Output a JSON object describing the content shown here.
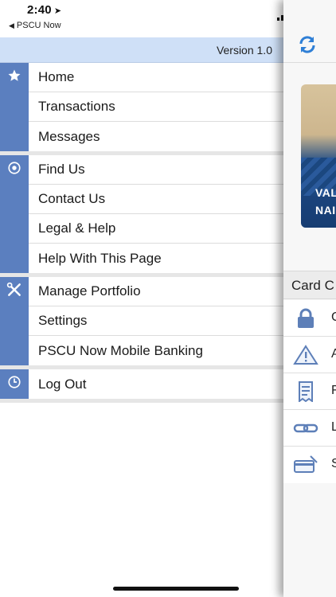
{
  "status_bar": {
    "time": "2:40",
    "back_app": "PSCU Now"
  },
  "menu": {
    "version": "Version 1.0",
    "groups": [
      {
        "icon": "star-icon",
        "items": [
          "Home",
          "Transactions",
          "Messages"
        ]
      },
      {
        "icon": "eye-icon",
        "items": [
          "Find Us",
          "Contact Us",
          "Legal & Help",
          "Help With This Page"
        ]
      },
      {
        "icon": "tools-icon",
        "items": [
          "Manage Portfolio",
          "Settings",
          "PSCU Now Mobile Banking"
        ]
      },
      {
        "icon": "clock-icon",
        "items": [
          "Log Out"
        ]
      }
    ]
  },
  "main_panel": {
    "banner_text": [
      "VAL",
      "NAI"
    ],
    "card_header": "Card C",
    "list": [
      {
        "icon": "lock-icon",
        "label": "C"
      },
      {
        "icon": "alert-icon",
        "label": "A"
      },
      {
        "icon": "statement-icon",
        "label": "F"
      },
      {
        "icon": "link-icon",
        "label": "L"
      },
      {
        "icon": "card-icon",
        "label": "S"
      }
    ]
  },
  "colors": {
    "rail": "#5b7fbf",
    "version_bar": "#cfe0f7",
    "accent_icon": "#2f7fd6"
  }
}
